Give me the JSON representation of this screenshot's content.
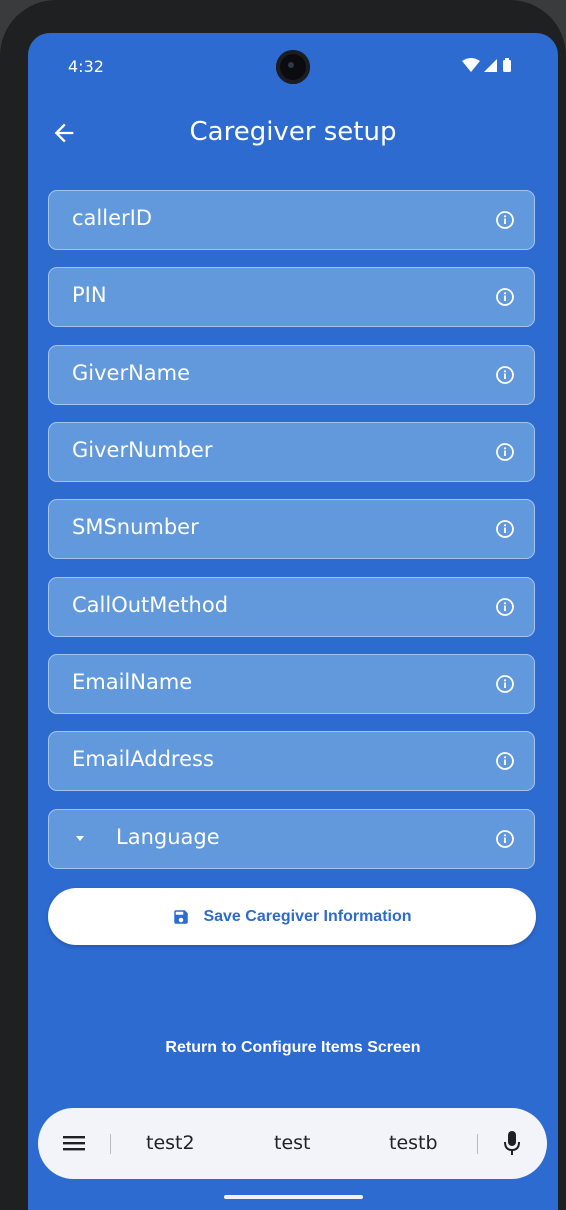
{
  "status_bar": {
    "time": "4:32",
    "icons": [
      "wifi-icon",
      "cellular-signal-icon",
      "battery-icon"
    ]
  },
  "app_bar": {
    "back_icon": "arrow-back-icon",
    "title": "Caregiver setup"
  },
  "form": {
    "fields": [
      {
        "label": "callerID",
        "icon": "info-icon"
      },
      {
        "label": "PIN",
        "icon": "info-icon"
      },
      {
        "label": "GiverName",
        "icon": "info-icon"
      },
      {
        "label": "GiverNumber",
        "icon": "info-icon"
      },
      {
        "label": "SMSnumber",
        "icon": "info-icon"
      },
      {
        "label": "CallOutMethod",
        "icon": "info-icon"
      },
      {
        "label": "EmailName",
        "icon": "info-icon"
      },
      {
        "label": "EmailAddress",
        "icon": "info-icon"
      }
    ],
    "language_dropdown": {
      "label": "Language",
      "icon": "info-icon"
    }
  },
  "save_button": {
    "label": "Save Caregiver Information",
    "icon": "save-icon"
  },
  "return_link": {
    "label": "Return to Configure Items Screen"
  },
  "keyboard": {
    "suggestions": [
      "test2",
      "test",
      "testb"
    ],
    "icons": [
      "menu-icon",
      "microphone-icon"
    ]
  },
  "colors": {
    "background": "#2d6bd1",
    "field_fill": "#6299dc",
    "field_border": "#a4c4ee",
    "button_text": "#2d6bd1",
    "keyboard_bar": "#f3f3fa"
  }
}
